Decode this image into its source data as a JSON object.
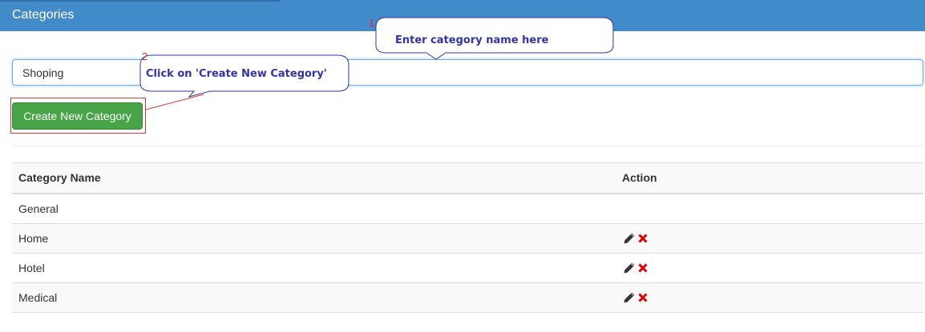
{
  "header": {
    "title": "Categories"
  },
  "form": {
    "category_value": "Shoping",
    "create_label": "Create New Category"
  },
  "table": {
    "headers": [
      "Category Name",
      "Action"
    ],
    "rows": [
      {
        "name": "General",
        "actions": []
      },
      {
        "name": "Home",
        "actions": [
          "pencil-icon",
          "delete-icon"
        ]
      },
      {
        "name": "Hotel",
        "actions": [
          "pencil-icon",
          "delete-icon"
        ]
      },
      {
        "name": "Medical",
        "actions": [
          "pencil-icon",
          "delete-icon"
        ]
      }
    ]
  },
  "annotations": [
    {
      "number": "1",
      "text": "Enter category name here"
    },
    {
      "number": "2",
      "text": "Click on 'Create New Category'"
    }
  ],
  "colors": {
    "header_bg": "#428bca",
    "button_bg": "#47a447",
    "delete_icon": "#e00000",
    "annotation_text": "#3333aa",
    "annotation_number": "#d32f2f"
  }
}
